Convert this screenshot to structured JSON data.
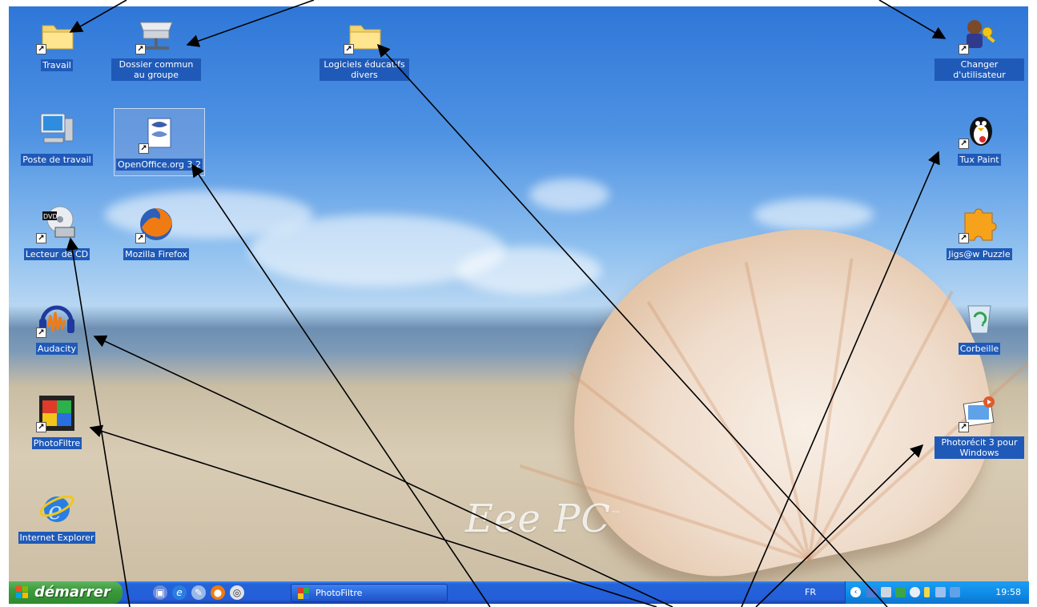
{
  "desktop": {
    "icons": [
      {
        "label": "Travail"
      },
      {
        "label": "Dossier commun au groupe"
      },
      {
        "label": "Logiciels éducatifs divers"
      },
      {
        "label": "Changer d'utilisateur"
      },
      {
        "label": "Poste de travail"
      },
      {
        "label": "OpenOffice.org 3.2"
      },
      {
        "label": "Tux Paint"
      },
      {
        "label": "Lecteur de CD"
      },
      {
        "label": "Mozilla Firefox"
      },
      {
        "label": "Jigs@w Puzzle"
      },
      {
        "label": "Audacity"
      },
      {
        "label": "Corbeille"
      },
      {
        "label": "PhotoFiltre"
      },
      {
        "label": "Photorécit 3 pour Windows"
      },
      {
        "label": "Internet Explorer"
      }
    ],
    "wallpaper_logo": "Eee PC",
    "wallpaper_logo_mark": "™",
    "dvd_label": "DVD"
  },
  "taskbar": {
    "start_label": "démarrer",
    "open_window": "PhotoFiltre",
    "language": "FR",
    "clock": "19:58"
  },
  "colors": {
    "taskbar_blue": "#245edb",
    "start_green": "#3c9b3c",
    "tray_blue": "#0d8ae6",
    "selection_blue": "#1f5ab8",
    "annotation_arrow": "#000000"
  }
}
